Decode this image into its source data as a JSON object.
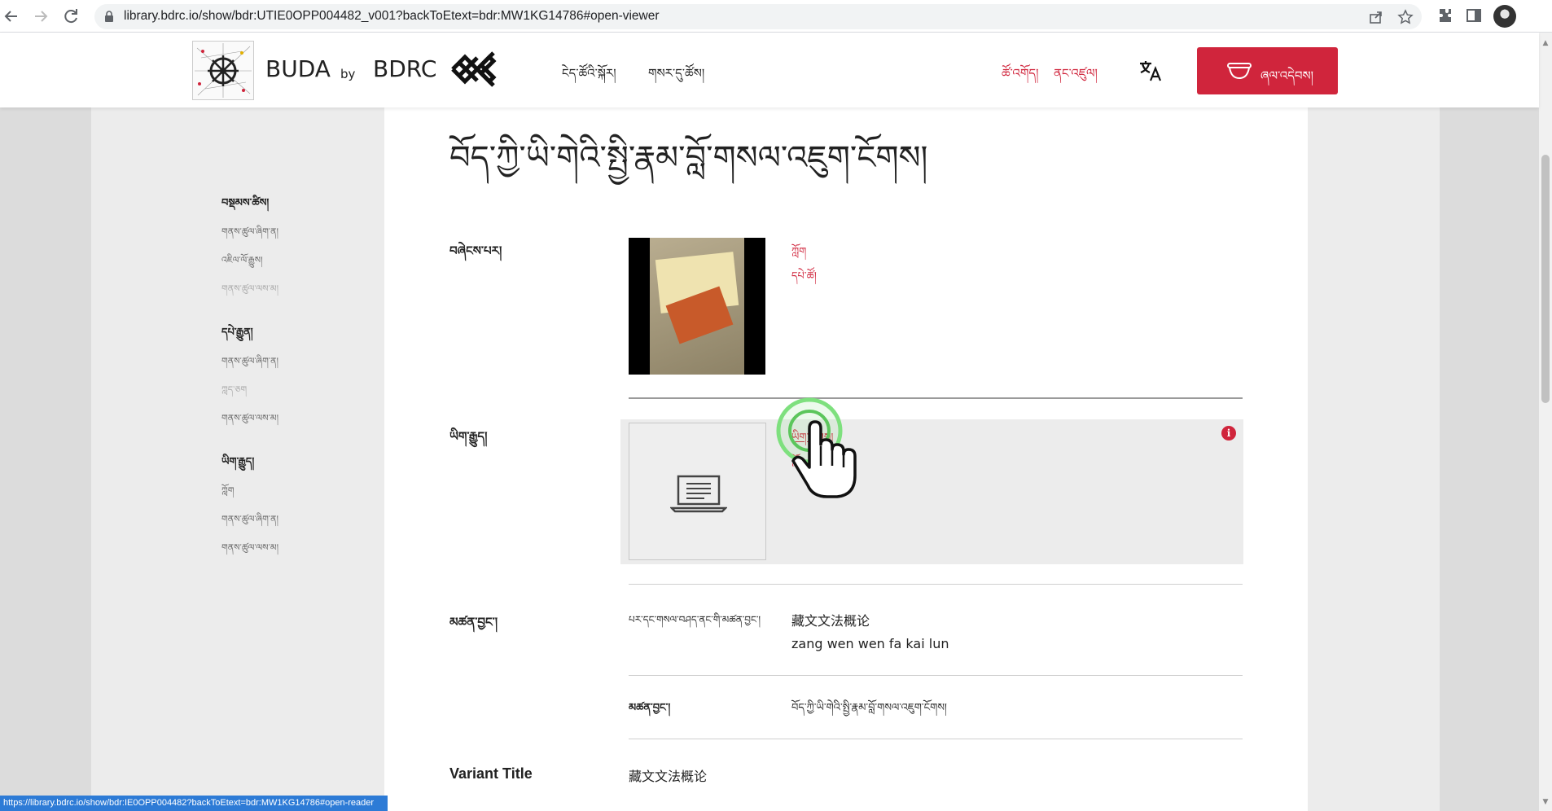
{
  "browser": {
    "url": "library.bdrc.io/show/bdr:UTIE0OPP004482_v001?backToEtext=bdr:MW1KG14786#open-viewer",
    "back_icon": "arrow-left-icon",
    "forward_icon": "arrow-right-icon",
    "reload_icon": "reload-icon"
  },
  "header": {
    "brand_buda": "BUDA",
    "brand_by": "by",
    "brand_bdrc": "BDRC",
    "nav": [
      "ངེད་ཚོའི་སྐོར།",
      "གསར་དུ་ཚོས།"
    ],
    "red_links": [
      "ཚོ་འགོད།",
      "ནང་འཛུལ།"
    ],
    "cta_label": "ཞལ་འདེབས།"
  },
  "sidebar": {
    "sections": [
      {
        "heading": "བསྡམས་ཚིས།",
        "items": [
          {
            "label": "གནས་ཚུལ་ཞིག་ན།",
            "dim": false
          },
          {
            "label": "འཇིལ་ལོ་རྒྱུས།",
            "dim": false
          },
          {
            "label": "གནས་ཚུལ་ལས་མ།",
            "dim": true
          }
        ]
      },
      {
        "heading": "དཔེ་རྒྱུན།",
        "items": [
          {
            "label": "གནས་ཚུལ་ཞིག་ན།",
            "dim": false
          },
          {
            "label": "ཀླད་ཅག",
            "dim": true
          },
          {
            "label": "གནས་ཚུལ་ལས་མ།",
            "dim": false
          }
        ]
      },
      {
        "heading": "ཡིག་རྒྱུད།",
        "items": [
          {
            "label": "ཀློག",
            "dim": false
          },
          {
            "label": "གནས་ཚུལ་ཞིག་ན།",
            "dim": false
          },
          {
            "label": "གནས་ཚུལ་ལས་མ།",
            "dim": false
          }
        ]
      }
    ]
  },
  "main": {
    "title": "བོད་ཀྱི་ཡི་གེའི་སྤྱི་རྣམ་བློ་གསལ་འཇུག་ངོགས།",
    "label_edition": "བཞེངས་པར།",
    "edition_links": [
      "ཀློག",
      "དཔེ་ཚོ།"
    ],
    "label_etext": "ཡིག་རྒྱུད།",
    "etext_link": "ཡིག་ཚགས།",
    "etext_link2": "ཀློ",
    "label_titles": "མཚན་བྱང་།",
    "title_row1_label": "པར་དང་གསལ་བཤད་ནང་གི་མཚན་བྱང་།",
    "title_row1_val1": "藏文文法概论",
    "title_row1_val2": "zang wen wen fa kai lun",
    "title_row2_label": "མཚན་བྱང་།",
    "title_row2_val": "བོད་ཀྱི་ཡི་གེའི་སྤྱི་རྣམ་བློ་གསལ་འཇུག་ངོགས།",
    "variant_label": "Variant Title",
    "variant_val": "藏文文法概论"
  },
  "status": "https://library.bdrc.io/show/bdr:IE0OPP004482?backToEtext=bdr:MW1KG14786#open-reader",
  "colors": {
    "accent": "#d0253c",
    "status": "#2d7bd6"
  }
}
